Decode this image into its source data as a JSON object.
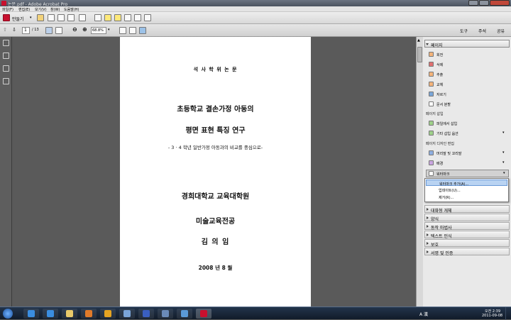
{
  "window": {
    "title": "논문.pdf - Adobe Acrobat Pro"
  },
  "menu": [
    "파일(F)",
    "편집(E)",
    "보기(V)",
    "창(W)",
    "도움말(H)"
  ],
  "toolbar1": {
    "create_label": "만들기"
  },
  "toolbar2": {
    "page_current": "1",
    "page_total": "/ 13",
    "zoom": "68.8%",
    "tools_tab": "도구",
    "comment_tab": "주석",
    "share_tab": "공유"
  },
  "document": {
    "heading": "석 사 학 위 논 문",
    "title_line1": "초등학교 결손가정 아동의",
    "title_line2": "평면 표현 특징 연구",
    "subtitle": "- 3 · 4 학년 일반가정 아동과의 비교를 중심으로-",
    "university": "경희대학교 교육대학원",
    "major": "미술교육전공",
    "author": "김 의 임",
    "date": "2008 년 8 월"
  },
  "panel": {
    "pages_header": "페이지",
    "pages_items": [
      "회전",
      "삭제",
      "추출",
      "교체",
      "자르기",
      "문서 분할"
    ],
    "insert_group": "페이지 삽입",
    "insert_items": [
      "파일에서 삽입",
      "기타 삽입 옵션"
    ],
    "design_group": "페이지 디자인 편집",
    "design_items": [
      "머리말 및 꼬리말",
      "배경",
      "워터마크"
    ],
    "dropdown_items": [
      "워터마크 추가(A)...",
      "업데이트(U)...",
      "제거(R)..."
    ],
    "collapsed_sections": [
      "대화형 개체",
      "양식",
      "동작 마법사",
      "텍스트 인식",
      "보호",
      "서명 및 인증"
    ]
  },
  "taskbar": {
    "ime": "A 漢",
    "time": "오전 2:39",
    "date": "2011-09-08"
  }
}
